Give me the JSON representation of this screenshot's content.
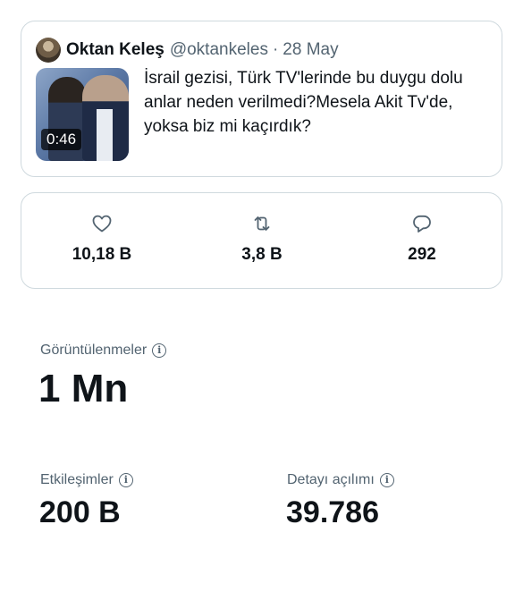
{
  "tweet": {
    "author_name": "Oktan Keleş",
    "author_handle": "@oktankeles",
    "separator": "·",
    "date": "28 May",
    "text": "İsrail gezisi, Türk TV'lerinde bu duygu dolu anlar neden verilmedi?Mesela Akit Tv'de, yoksa biz mi kaçırdık?",
    "video_duration": "0:46"
  },
  "stats": {
    "likes": "10,18 B",
    "retweets": "3,8 B",
    "replies": "292",
    "icons": [
      "heart-icon",
      "retweet-icon",
      "reply-icon"
    ]
  },
  "metrics": {
    "views_label": "Görüntülenmeler",
    "views_value": "1 Mn",
    "engagements_label": "Etkileşimler",
    "engagements_value": "200 B",
    "detail_expands_label": "Detayı açılımı",
    "detail_expands_value": "39.786",
    "info_glyph": "i"
  },
  "colors": {
    "text_primary": "#0f1419",
    "text_secondary": "#536471",
    "border": "#cfd9de"
  }
}
